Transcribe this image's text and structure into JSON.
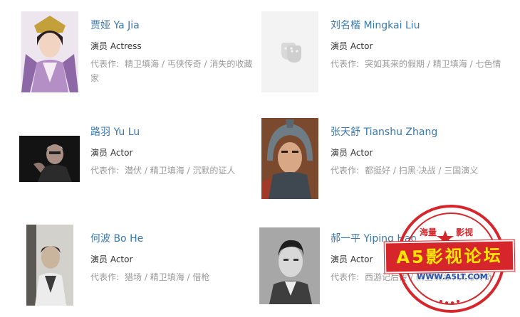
{
  "people": [
    {
      "name": "贾娅 Ya Jia",
      "role": "演员 Actress",
      "works_label": "代表作:",
      "works": "精卫填海 / 丐侠传奇 / 消失的收藏家"
    },
    {
      "name": "刘名楷 Mingkai Liu",
      "role": "演员 Actor",
      "works_label": "代表作:",
      "works": "突如其来的假期 / 精卫填海 / 七色情"
    },
    {
      "name": "路羽 Yu Lu",
      "role": "演员 Actor",
      "works_label": "代表作:",
      "works": "潜伏 / 精卫填海 / 沉默的证人"
    },
    {
      "name": "张天舒 Tianshu Zhang",
      "role": "演员 Actor",
      "works_label": "代表作:",
      "works": "都挺好 / 扫黑·决战 / 三国演义"
    },
    {
      "name": "何波 Bo He",
      "role": "演员 Actor",
      "works_label": "代表作:",
      "works": "猎场 / 精卫填海 / 借枪"
    },
    {
      "name": "郝一平 Yiping Hao",
      "role": "演员 Actor",
      "works_label": "代表作:",
      "works": "西游记后传 / 精卫填海 / 大帝传奇"
    }
  ],
  "watermark": {
    "top_left": "海量",
    "top_right": "影视",
    "banner": "A5影视论坛",
    "url": "WWW.A5LT.COM"
  }
}
